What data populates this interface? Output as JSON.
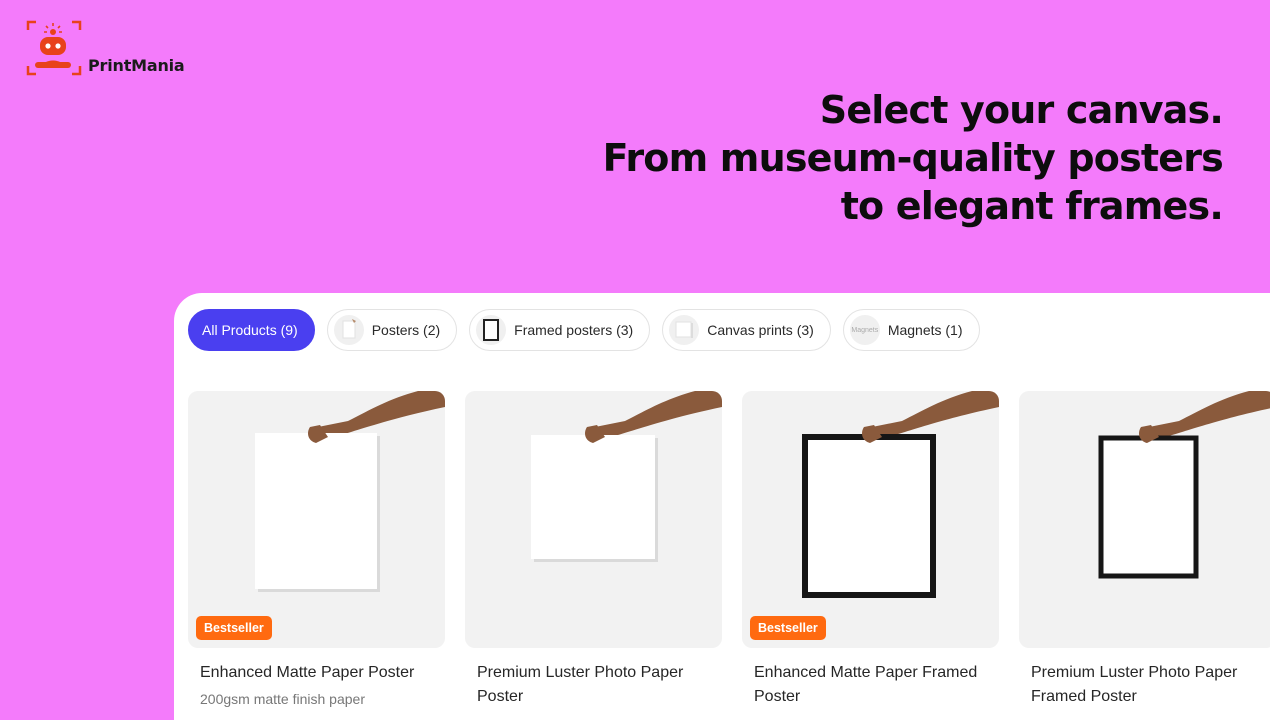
{
  "brand": {
    "name": "PrintMania",
    "accent": "#e8421b"
  },
  "headline": {
    "line1": "Select your canvas.",
    "line2": "From museum-quality posters",
    "line3": "to elegant frames."
  },
  "tabs": [
    {
      "label": "All Products (9)",
      "active": true,
      "icon": "none"
    },
    {
      "label": "Posters (2)",
      "active": false,
      "icon": "poster-thumbnail"
    },
    {
      "label": "Framed posters (3)",
      "active": false,
      "icon": "framed-poster-thumbnail"
    },
    {
      "label": "Canvas prints (3)",
      "active": false,
      "icon": "canvas-thumbnail"
    },
    {
      "label": "Magnets (1)",
      "active": false,
      "icon": "magnet-thumbnail",
      "thumb_text": "Magnets"
    }
  ],
  "products": [
    {
      "title": "Enhanced Matte Paper Poster",
      "subtitle": "200gsm matte finish paper",
      "badge": "Bestseller",
      "image": "hand-holding-poster"
    },
    {
      "title": "Premium Luster Photo Paper Poster",
      "subtitle": "",
      "badge": "",
      "image": "hand-holding-poster"
    },
    {
      "title": "Enhanced Matte Paper Framed Poster",
      "subtitle": "",
      "badge": "Bestseller",
      "image": "hand-holding-framed-poster"
    },
    {
      "title": "Premium Luster Photo Paper Framed Poster",
      "subtitle": "",
      "badge": "",
      "image": "hand-holding-framed-poster"
    }
  ],
  "colors": {
    "background": "#f47bfb",
    "active_tab": "#4a3ff0",
    "badge": "#ff6a10"
  }
}
